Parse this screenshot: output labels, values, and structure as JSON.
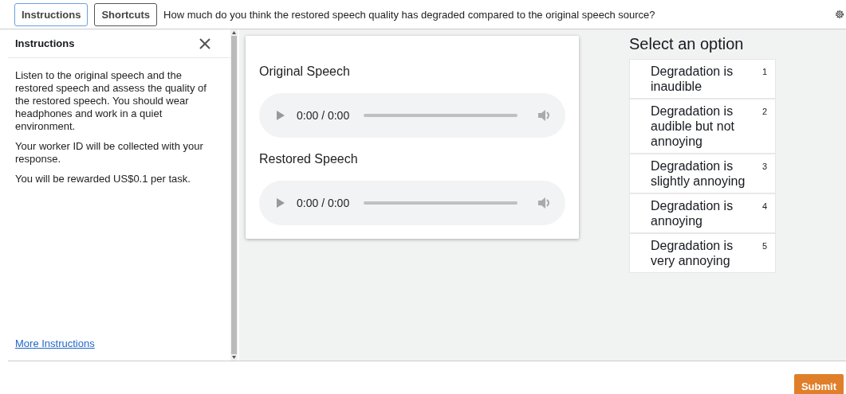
{
  "top_bar": {
    "buttons": [
      {
        "label": "Instructions",
        "selected": true
      },
      {
        "label": "Shortcuts",
        "selected": false
      }
    ],
    "question": "How much do you think the restored speech quality has degraded compared to the original speech source?"
  },
  "instructions_panel": {
    "title": "Instructions",
    "paragraphs": [
      "Listen to the original speech and the restored speech and assess the quality of the restored speech. You should wear headphones and work in a quiet environment.",
      "Your worker ID will be collected with your response.",
      "You will be rewarded US$0.1 per task."
    ],
    "link": "More Instructions"
  },
  "audio_card": {
    "players": [
      {
        "label": "Original Speech",
        "time": "0:00 / 0:00"
      },
      {
        "label": "Restored Speech",
        "time": "0:00 / 0:00"
      }
    ]
  },
  "options": {
    "title": "Select an option",
    "items": [
      {
        "label": "Degradation is inaudible",
        "shortcut": "1",
        "selected": false
      },
      {
        "label": "Degradation is audible but not annoying",
        "shortcut": "2",
        "selected": false
      },
      {
        "label": "Degradation is slightly annoying",
        "shortcut": "3",
        "selected": false
      },
      {
        "label": "Degradation is annoying",
        "shortcut": "4",
        "selected": false
      },
      {
        "label": "Degradation is very annoying",
        "shortcut": "5",
        "selected": false
      }
    ]
  },
  "submit": "Submit"
}
